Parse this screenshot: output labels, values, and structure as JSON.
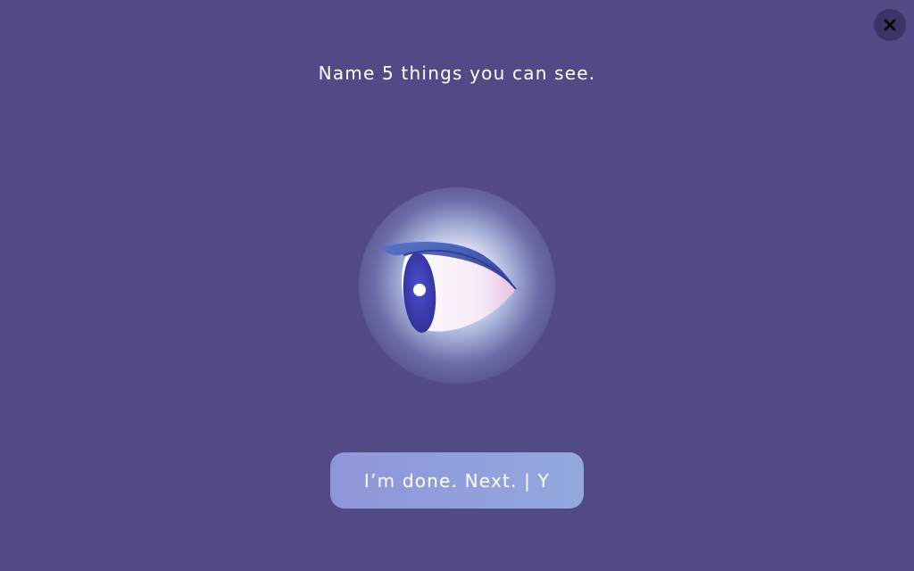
{
  "close_button": {
    "label": "X",
    "icon": "close-icon"
  },
  "prompt": {
    "text": "Name 5 things you can see."
  },
  "illustration": {
    "icon": "eye-icon",
    "glow_color": "#ffffff",
    "iris_color": "#3d3fb0"
  },
  "next_button": {
    "label": "I’m done. Next. | Y"
  },
  "colors": {
    "background": "#524a87",
    "button_gradient_start": "#8f95d9",
    "button_gradient_end": "#93a9de",
    "text": "#ffffff"
  }
}
